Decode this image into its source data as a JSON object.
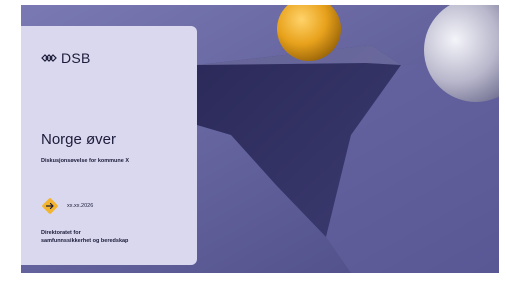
{
  "logo": {
    "icon": "dsb-logo-icon",
    "text": "DSB"
  },
  "title": "Norge øver",
  "subtitle": "Diskusjonsøvelse for kommune X",
  "date": "xx.xx.2026",
  "organization": {
    "line1": "Direktoratet for",
    "line2": "samfunnssikkerhet og beredskap"
  },
  "colors": {
    "panel": "#d9d8ee",
    "accent": "#f4b52e",
    "text": "#1c1b3a",
    "background": "#575694"
  },
  "icons": {
    "arrow": "arrow-right-icon"
  }
}
